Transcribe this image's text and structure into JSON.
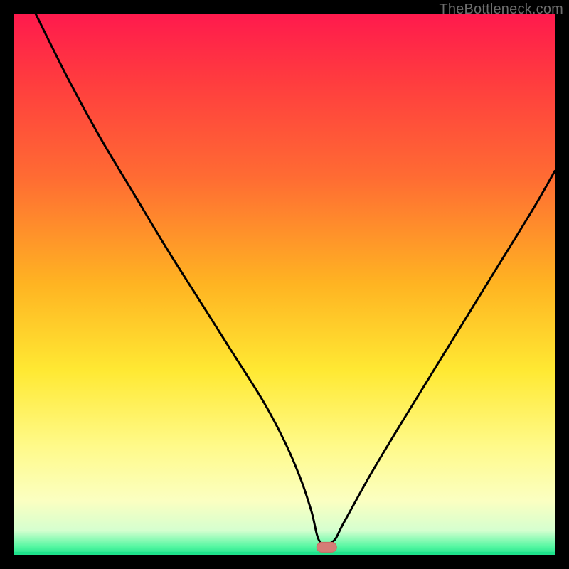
{
  "attribution": "TheBottleneck.com",
  "colors": {
    "frame": "#000000",
    "curve": "#000000",
    "marker_fill": "#d57d76",
    "marker_stroke": "#c96a63",
    "greenLine": "#1fe28c",
    "gradient_stops": [
      {
        "offset": 0.0,
        "color": "#ff1a4d"
      },
      {
        "offset": 0.12,
        "color": "#ff3b3f"
      },
      {
        "offset": 0.3,
        "color": "#ff6b33"
      },
      {
        "offset": 0.5,
        "color": "#ffb422"
      },
      {
        "offset": 0.66,
        "color": "#ffe933"
      },
      {
        "offset": 0.8,
        "color": "#fffa8a"
      },
      {
        "offset": 0.9,
        "color": "#fbffc1"
      },
      {
        "offset": 0.955,
        "color": "#d5ffcf"
      },
      {
        "offset": 0.985,
        "color": "#55f7a2"
      },
      {
        "offset": 1.0,
        "color": "#1fe28c"
      }
    ]
  },
  "chart_data": {
    "type": "line",
    "title": "",
    "xlabel": "",
    "ylabel": "",
    "xlim": [
      0,
      100
    ],
    "ylim": [
      0,
      100
    ],
    "series": [
      {
        "name": "bottleneck-curve",
        "x": [
          4,
          10,
          16,
          22,
          28,
          34,
          40,
          46,
          50,
          53,
          55,
          56.5,
          59,
          61,
          66,
          72,
          80,
          88,
          96,
          100
        ],
        "values": [
          100,
          88,
          77,
          67,
          57,
          47.5,
          38,
          28.5,
          21,
          14,
          8,
          2.5,
          2.5,
          6,
          15,
          25,
          38,
          51,
          64,
          71
        ]
      }
    ],
    "annotations": [
      {
        "name": "optimal-marker",
        "x": 57.8,
        "y": 1.4,
        "shape": "pill"
      }
    ],
    "grid": false,
    "legend": false
  }
}
